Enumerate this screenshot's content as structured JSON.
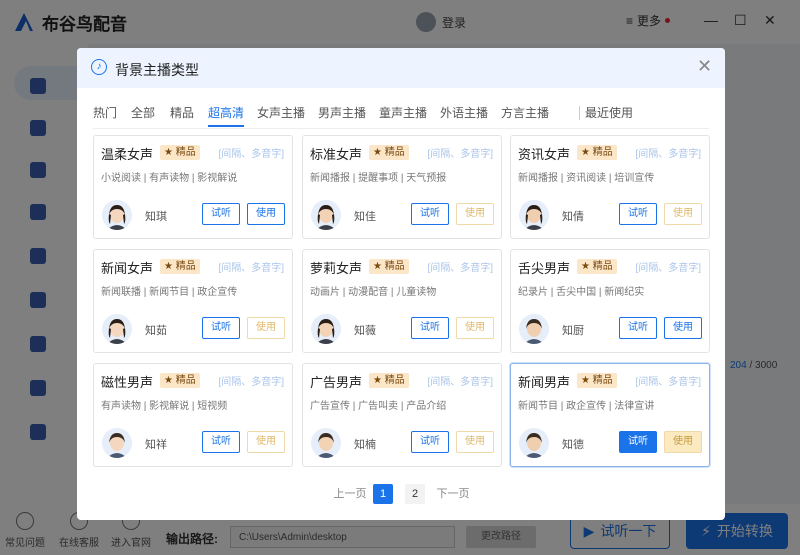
{
  "app": {
    "title": "布谷鸟配音",
    "login_label": "登录",
    "more_label": "更多"
  },
  "counter": {
    "current": "204",
    "total": " / 3000"
  },
  "bottom": {
    "links": [
      "常见问题",
      "在线客服",
      "进入官网"
    ],
    "output_label": "输出路径:",
    "output_path": "C:\\Users\\Admin\\desktop",
    "change_path_label": "更改路径",
    "listen_label": "试听一下",
    "convert_label": "开始转换"
  },
  "modal": {
    "title": "背景主播类型",
    "tabs": [
      "热门",
      "全部",
      "精品",
      "超高清",
      "女声主播",
      "男声主播",
      "童声主播",
      "外语主播",
      "方言主播",
      "最近使用"
    ],
    "active_tab": "超高清",
    "badge_label": "★ 精品",
    "tags_label": "[间隔、多音字]",
    "try_label": "试听",
    "use_label": "使用",
    "cards": [
      {
        "name": "温柔女声",
        "desc": "小说阅读 | 有声读物 | 影视解说",
        "voice": "知琪",
        "use_enabled": true,
        "selected": false
      },
      {
        "name": "标准女声",
        "desc": "新闻播报 | 提醒事项 | 天气预报",
        "voice": "知佳",
        "use_enabled": false,
        "selected": false
      },
      {
        "name": "资讯女声",
        "desc": "新闻播报 | 资讯阅读 | 培训宣传",
        "voice": "知倩",
        "use_enabled": false,
        "selected": false
      },
      {
        "name": "新闻女声",
        "desc": "新闻联播 | 新闻节目 | 政企宣传",
        "voice": "知茹",
        "use_enabled": false,
        "selected": false
      },
      {
        "name": "萝莉女声",
        "desc": "动画片 | 动漫配音 | 儿童读物",
        "voice": "知薇",
        "use_enabled": false,
        "selected": false
      },
      {
        "name": "舌尖男声",
        "desc": "纪录片 | 舌尖中国 | 新闻纪实",
        "voice": "知厨",
        "use_enabled": true,
        "selected": false
      },
      {
        "name": "磁性男声",
        "desc": "有声读物 | 影视解说 | 短视频",
        "voice": "知祥",
        "use_enabled": false,
        "selected": false
      },
      {
        "name": "广告男声",
        "desc": "广告宣传 | 广告叫卖 | 产品介绍",
        "voice": "知楠",
        "use_enabled": false,
        "selected": false
      },
      {
        "name": "新闻男声",
        "desc": "新闻节目 | 政企宣传 | 法律宣讲",
        "voice": "知德",
        "use_enabled": false,
        "selected": true
      }
    ],
    "pager": {
      "prev": "上一页",
      "pages": [
        "1",
        "2"
      ],
      "active_page": "1",
      "next": "下一页"
    }
  }
}
